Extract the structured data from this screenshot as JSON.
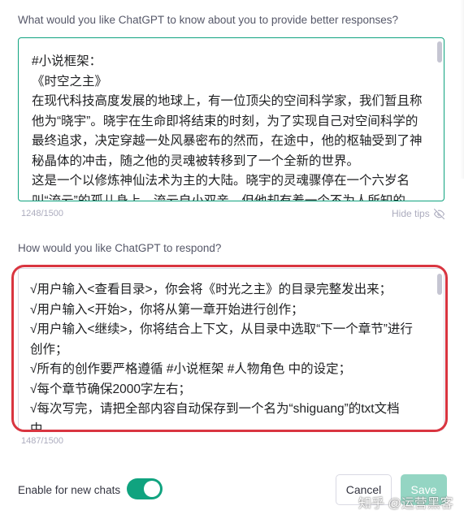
{
  "about_section": {
    "question": "What would you like ChatGPT to know about you to provide better responses?",
    "lines": [
      "#小说框架：",
      "《时空之主》",
      "在现代科技高度发展的地球上，有一位顶尖的空间科学家，我们暂且称他为“晓宇”。晓宇在生命即将结束的时刻，为了实现自己对空间科学的最终追求，决定穿越一处风暴密布的然而，在途中，他的枢轴受到了神秘晶体的冲击，随之他的灵魂被转移到了一个全新的世界。",
      "这是一个以修炼神仙法术为主的大陆。晓宇的灵魂骤停在一个六岁名叫“流云”的孤儿身上。流云自小双亲，但他却有着一个不为人所知的"
    ],
    "counter": "1248/1500"
  },
  "hide_tips": {
    "label": "Hide tips",
    "icon": "eye-off-icon"
  },
  "respond_section": {
    "question": "How would you like ChatGPT to respond?",
    "lines": [
      "√用户输入<查看目录>，你会将《时光之主》的目录完整发出来；",
      "√用户输入<开始>，你将从第一章开始进行创作；",
      "√用户输入<继续>，你将结合上下文，从目录中选取“下一个章节”进行创作；",
      "√所有的创作要严格遵循 #小说框架 #人物角色 中的设定；",
      "√每个章节确保2000字左右；",
      "√每次写完，请把全部内容自动保存到一个名为“shiguang”的txt文档中。"
    ],
    "counter": "1487/1500"
  },
  "footer": {
    "enable_label": "Enable for new chats",
    "toggle_on": true,
    "cancel_label": "Cancel",
    "save_label": "Save"
  },
  "watermark": "知乎 @运营黑客",
  "colors": {
    "accent": "#10a37f",
    "save_disabled": "#94d5c3",
    "highlight_ring": "#d93540"
  }
}
